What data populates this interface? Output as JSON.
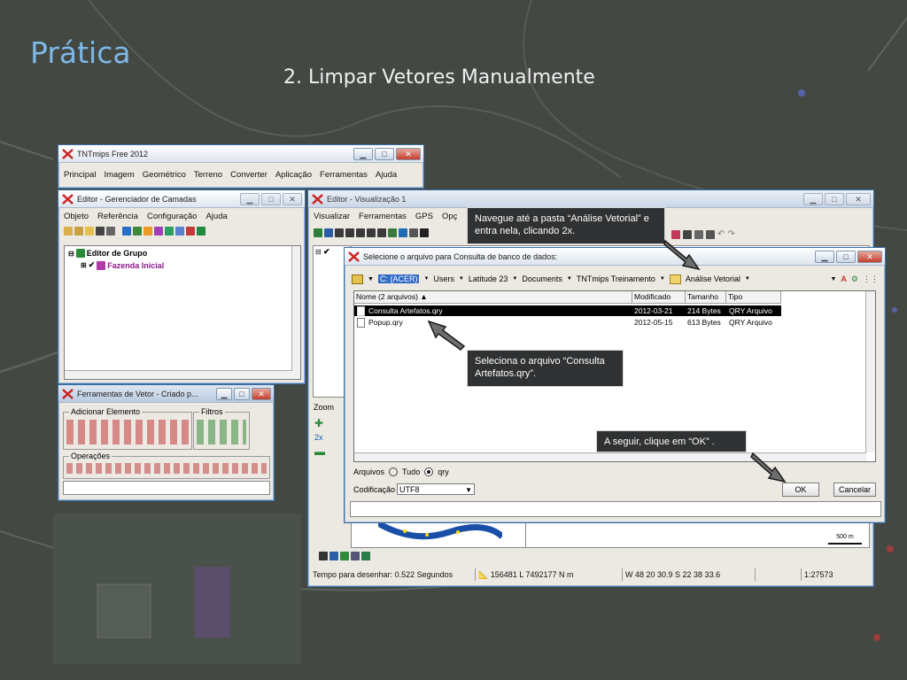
{
  "slide": {
    "title": "Prática",
    "subtitle": "2. Limpar Vetores Manualmente"
  },
  "main_window": {
    "title": "TNTmips Free 2012",
    "menu": [
      "Principal",
      "Imagem",
      "Geométrico",
      "Terreno",
      "Converter",
      "Aplicação",
      "Ferramentas",
      "Ajuda"
    ]
  },
  "layer_manager": {
    "title": "Editor - Gerenciador de Camadas",
    "menu": [
      "Objeto",
      "Referência",
      "Configuração",
      "Ajuda"
    ],
    "tree": {
      "group": "Editor de Grupo",
      "layer": "Fazenda Inicial"
    }
  },
  "vector_tools": {
    "title": "Ferramentas de Vetor - Criado p...",
    "groups": {
      "add": "Adicionar Elemento",
      "filters": "Filtros",
      "operations": "Operações"
    }
  },
  "view_window": {
    "title": "Editor - Visualização 1",
    "menu": [
      "Visualizar",
      "Ferramentas",
      "GPS",
      "Opç"
    ],
    "zoom_label": "Zoom",
    "zoom_value": "2x",
    "scale_bar": "500 m",
    "status": {
      "draw_time": "Tempo para desenhar: 0.522 Segundos",
      "coords": "156481 L  7492177 N m",
      "latlon": "W 48 20 30.9  S 22 38 33.6",
      "scale": "1:27573"
    }
  },
  "file_dialog": {
    "title": "Selecione o arquivo para Consulta de banco de dados:",
    "path": [
      "C: (ACER)",
      "Users",
      "Latitude 23",
      "Documents",
      "TNTmips Treinamento",
      "Análise Vetorial"
    ],
    "columns": {
      "name": "Nome  (2 arquivos)",
      "modified": "Modificado",
      "size": "Tamanho",
      "type": "Tipo"
    },
    "files": [
      {
        "name": "Consulta Artefatos.qry",
        "modified": "2012-03-21",
        "size": "214 Bytes",
        "type": "QRY Arquivo",
        "selected": true
      },
      {
        "name": "Popup.qry",
        "modified": "2012-05-15",
        "size": "613 Bytes",
        "type": "QRY Arquivo",
        "selected": false
      }
    ],
    "files_label": "Arquivos",
    "filter_all": "Tudo",
    "filter_qry": "qry",
    "encoding_label": "Codificação",
    "encoding_value": "UTF8",
    "ok_label": "OK",
    "cancel_label": "Cancelar"
  },
  "callouts": {
    "navigate": "Navegue até a pasta “Análise Vetorial” e entra nela, clicando 2x.",
    "select": "Seleciona o arquivo “Consulta Artefatos.qry”.",
    "then_ok": "A seguir, clique em “OK” ."
  },
  "colors": {
    "title_blue": "#7eb8e6",
    "selection": "#000000",
    "callout_bg": "#2f3133"
  }
}
